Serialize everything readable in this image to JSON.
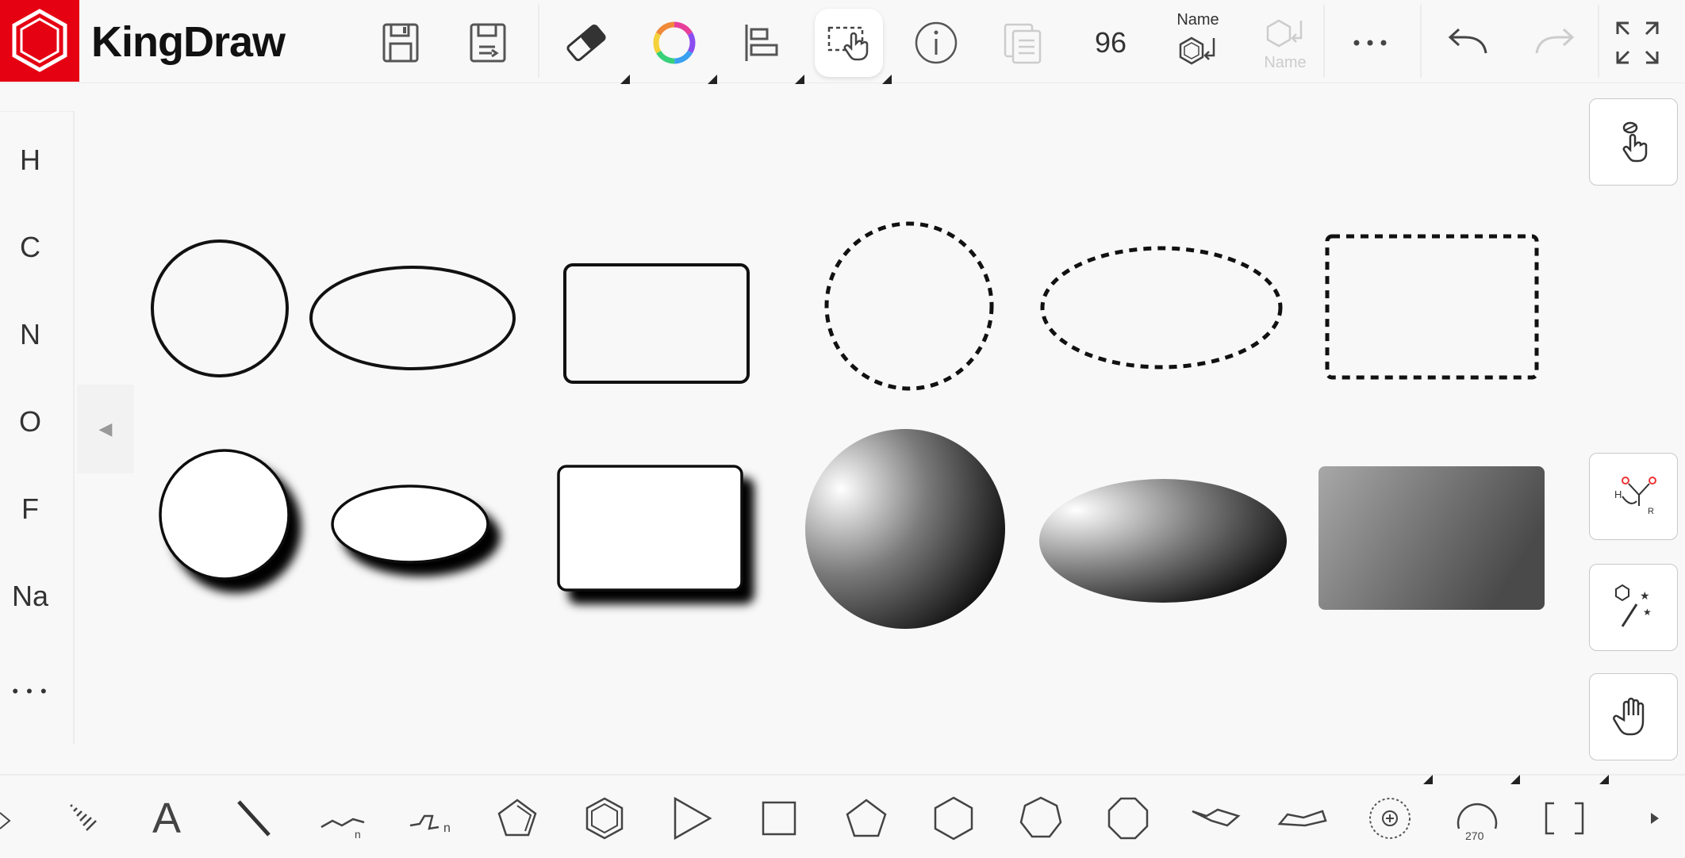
{
  "app": {
    "title": "KingDraw",
    "brand_color": "#e50012"
  },
  "toolbar": {
    "font_size": "96",
    "name_label_active": "Name",
    "name_label_disabled": "Name",
    "icons": [
      "save-icon",
      "save-as-icon",
      "eraser-icon",
      "color-wheel-icon",
      "align-left-icon",
      "select-hand-icon",
      "info-icon",
      "copy-icon",
      "structure-to-name-icon",
      "name-to-structure-icon",
      "more-icon",
      "undo-icon",
      "redo-icon",
      "fullscreen-icon"
    ]
  },
  "elements_panel": {
    "items": [
      "H",
      "C",
      "N",
      "O",
      "F",
      "Na"
    ],
    "more": "• • •"
  },
  "side_tools": [
    "pen-select-icon",
    "reaction-mechanism-icon",
    "magic-wand-icon",
    "hand-pan-icon"
  ],
  "bottom_tools": {
    "chain_label": "n",
    "chain2_label": "n",
    "arc_label": "270",
    "text_tool": "A",
    "items": [
      "wedge-bond-icon",
      "hashed-bond-icon",
      "text-tool-icon",
      "single-bond-icon",
      "chain-icon",
      "chain-n-icon",
      "cyclopentadiene-icon",
      "benzene-icon",
      "triangle-icon",
      "square-icon",
      "pentagon-icon",
      "hexagon-icon",
      "heptagon-icon",
      "octagon-icon",
      "chair-cyclohexane-icon",
      "boat-cyclohexane-icon",
      "charge-plus-icon",
      "arc-270-icon",
      "bracket-icon",
      "scroll-right-icon"
    ]
  },
  "canvas": {
    "shapes": [
      "circle-plain",
      "ellipse-plain",
      "rect-plain",
      "circle-dashed",
      "ellipse-dashed",
      "rect-dashed",
      "circle-shadow",
      "ellipse-shadow",
      "rect-shadow",
      "sphere-gradient",
      "ellipse-gradient",
      "rect-gradient"
    ]
  }
}
